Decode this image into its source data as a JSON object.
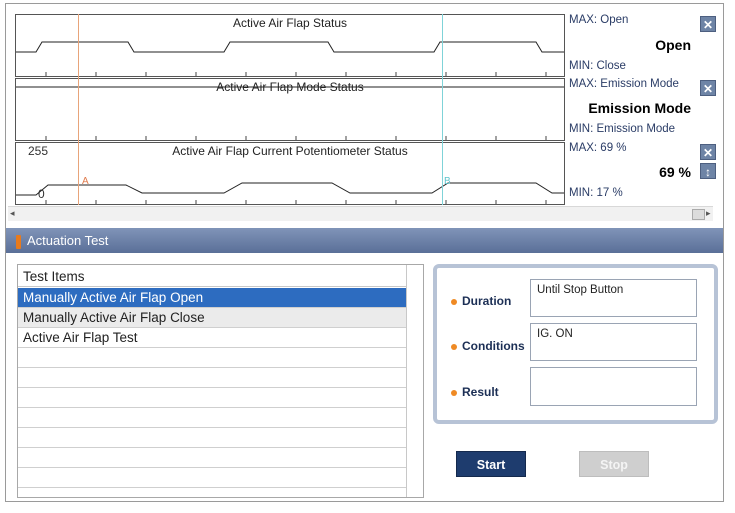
{
  "graphs": [
    {
      "title": "Active Air Flap Status",
      "max": "MAX: Open",
      "current": "Open",
      "min": "MIN: Close",
      "close_btn": "✕"
    },
    {
      "title": "Active Air Flap Mode Status",
      "max": "MAX: Emission Mode",
      "current": "Emission Mode",
      "min": "MIN: Emission Mode",
      "close_btn": "✕"
    },
    {
      "title": "Active Air Flap Current Potentiometer Status",
      "ymax": "255",
      "ymin": "0",
      "marker_a": "A",
      "marker_b": "B",
      "max": "MAX:    69 %",
      "current": "69 %",
      "min": "MIN:    17 %",
      "close_btn": "✕",
      "updown_btn": "↕"
    }
  ],
  "section": {
    "title": "Actuation Test"
  },
  "test_items": {
    "header": "Test Items",
    "rows": [
      "Manually Active Air Flap Open",
      "Manually Active Air Flap Close",
      "Active Air Flap Test"
    ]
  },
  "details": {
    "duration_label": "Duration",
    "duration_value": "Until Stop Button",
    "conditions_label": "Conditions",
    "conditions_value": "IG. ON",
    "result_label": "Result",
    "result_value": ""
  },
  "buttons": {
    "start": "Start",
    "stop": "Stop"
  },
  "colors": {
    "cursor_orange": "#e8a47a",
    "cursor_cyan": "#7fd3d8",
    "selection": "#2d6cc0",
    "header_bar": "#6a7fa6",
    "accent_orange": "#ef8a24"
  }
}
